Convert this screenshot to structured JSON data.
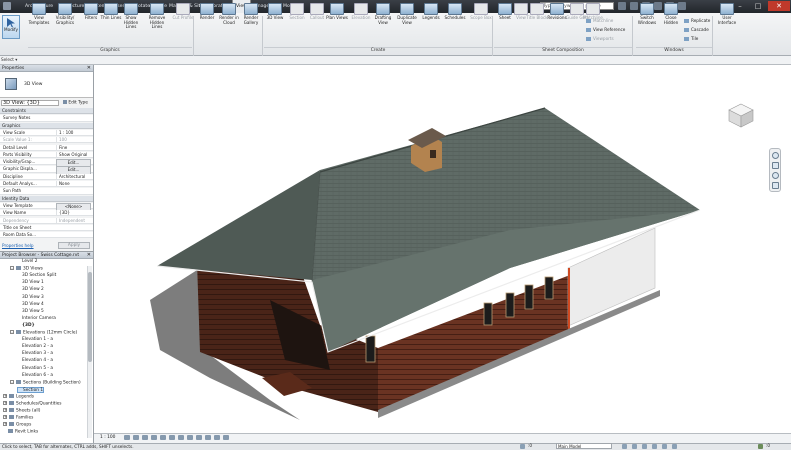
{
  "app": {
    "search_placeholder": "Type a keyword or phrase"
  },
  "tabs": [
    "Architecture",
    "Structure",
    "Systems",
    "Insert",
    "Annotate",
    "Analyze",
    "Massing & Site",
    "Collaborate",
    "View",
    "Manage",
    "Modify"
  ],
  "active_tab_index": 8,
  "ribbon": {
    "modify": "Modify",
    "select": "Select ▾",
    "graphics": {
      "panel_label": "Graphics",
      "buttons": [
        {
          "label": "View Templates",
          "enabled": true
        },
        {
          "label": "Visibility/ Graphics",
          "enabled": true
        },
        {
          "label": "Filters",
          "enabled": true
        },
        {
          "label": "Thin Lines",
          "enabled": true
        },
        {
          "label": "Show Hidden Lines",
          "enabled": true
        },
        {
          "label": "Remove Hidden Lines",
          "enabled": true
        },
        {
          "label": "Cut Profile",
          "enabled": false
        }
      ]
    },
    "presentation": {
      "buttons": [
        {
          "label": "Render",
          "enabled": true
        },
        {
          "label": "Render in Cloud",
          "enabled": true
        },
        {
          "label": "Render Gallery",
          "enabled": true
        }
      ]
    },
    "create": {
      "panel_label": "Create",
      "buttons": [
        {
          "label": "3D View",
          "enabled": true
        },
        {
          "label": "Section",
          "enabled": false
        },
        {
          "label": "Callout",
          "enabled": false
        },
        {
          "label": "Plan Views",
          "enabled": true
        },
        {
          "label": "Elevation",
          "enabled": false
        },
        {
          "label": "Drafting View",
          "enabled": true
        },
        {
          "label": "Duplicate View",
          "enabled": true
        },
        {
          "label": "Legends",
          "enabled": true
        },
        {
          "label": "Schedules",
          "enabled": true
        },
        {
          "label": "Scope Box",
          "enabled": false
        }
      ]
    },
    "sheet_composition": {
      "panel_label": "Sheet Composition",
      "buttons": [
        {
          "label": "Sheet",
          "enabled": true
        },
        {
          "label": "View",
          "enabled": false
        },
        {
          "label": "Title Block",
          "enabled": false
        },
        {
          "label": "Revisions",
          "enabled": true
        },
        {
          "label": "Guide Grid",
          "enabled": false
        },
        {
          "label": "Matchline",
          "enabled": false
        }
      ],
      "small": [
        {
          "label": "Matchline",
          "enabled": false
        },
        {
          "label": "View Reference",
          "enabled": true
        },
        {
          "label": "Viewports",
          "enabled": false
        }
      ]
    },
    "windows": {
      "panel_label": "Windows",
      "buttons": [
        {
          "label": "Switch Windows",
          "enabled": true
        },
        {
          "label": "Close Hidden",
          "enabled": true
        }
      ],
      "small": [
        "Replicate",
        "Cascade",
        "Tile"
      ],
      "ui_button": "User Interface"
    }
  },
  "properties": {
    "title": "Properties",
    "view_type": "3D View",
    "instance_selector": "3D View: {3D}",
    "edit_type": "Edit Type",
    "rows": [
      {
        "kind": "cat",
        "k": "Constraints"
      },
      {
        "kind": "row",
        "k": "Survey Notes",
        "v": ""
      },
      {
        "kind": "cat",
        "k": "Graphics"
      },
      {
        "kind": "row",
        "k": "View Scale",
        "v": "1 : 100"
      },
      {
        "kind": "row",
        "k": "Scale Value  1:",
        "v": "100",
        "dim": true
      },
      {
        "kind": "row",
        "k": "Detail Level",
        "v": "Fine"
      },
      {
        "kind": "row",
        "k": "Parts Visibility",
        "v": "Show Original"
      },
      {
        "kind": "row",
        "k": "Visibility/Grap...",
        "v": "Edit...",
        "btn": true
      },
      {
        "kind": "row",
        "k": "Graphic Displa...",
        "v": "Edit...",
        "btn": true
      },
      {
        "kind": "row",
        "k": "Discipline",
        "v": "Architectural"
      },
      {
        "kind": "row",
        "k": "Default Analys...",
        "v": "None"
      },
      {
        "kind": "row",
        "k": "Sun Path",
        "v": ""
      },
      {
        "kind": "cat",
        "k": "Identity Data"
      },
      {
        "kind": "row",
        "k": "View Template",
        "v": "<None>",
        "btn": true
      },
      {
        "kind": "row",
        "k": "View Name",
        "v": "{3D}"
      },
      {
        "kind": "row",
        "k": "Dependency",
        "v": "Independent",
        "dim": true
      },
      {
        "kind": "row",
        "k": "Title on Sheet",
        "v": ""
      },
      {
        "kind": "row",
        "k": "Room Data So...",
        "v": ""
      }
    ],
    "help_link": "Properties help",
    "apply": "Apply"
  },
  "project_browser": {
    "title": "Project Browser - Swiss Cottage.rvt",
    "items": [
      {
        "depth": 2,
        "label": "Level 2",
        "toggle": ""
      },
      {
        "depth": 1,
        "label": "3D Views",
        "toggle": "-"
      },
      {
        "depth": 2,
        "label": "3D Section Split",
        "toggle": ""
      },
      {
        "depth": 2,
        "label": "3D View 1",
        "toggle": ""
      },
      {
        "depth": 2,
        "label": "3D View 2",
        "toggle": ""
      },
      {
        "depth": 2,
        "label": "3D View 3",
        "toggle": ""
      },
      {
        "depth": 2,
        "label": "3D View 4",
        "toggle": ""
      },
      {
        "depth": 2,
        "label": "3D View 5",
        "toggle": ""
      },
      {
        "depth": 2,
        "label": "Interior Camera",
        "toggle": ""
      },
      {
        "depth": 2,
        "label": "{3D}",
        "toggle": "",
        "bold": true
      },
      {
        "depth": 1,
        "label": "Elevations (12mm Circle)",
        "toggle": "-"
      },
      {
        "depth": 2,
        "label": "Elevation 1 - a",
        "toggle": ""
      },
      {
        "depth": 2,
        "label": "Elevation 2 - a",
        "toggle": ""
      },
      {
        "depth": 2,
        "label": "Elevation 3 - a",
        "toggle": ""
      },
      {
        "depth": 2,
        "label": "Elevation 4 - a",
        "toggle": ""
      },
      {
        "depth": 2,
        "label": "Elevation 5 - a",
        "toggle": ""
      },
      {
        "depth": 2,
        "label": "Elevation 6 - a",
        "toggle": ""
      },
      {
        "depth": 1,
        "label": "Sections (Building Section)",
        "toggle": "-"
      },
      {
        "depth": 2,
        "label": "Section 1",
        "toggle": "",
        "selected": true
      },
      {
        "depth": 0,
        "label": "Legends",
        "toggle": "+"
      },
      {
        "depth": 0,
        "label": "Schedules/Quantities",
        "toggle": "+"
      },
      {
        "depth": 0,
        "label": "Sheets (all)",
        "toggle": "+"
      },
      {
        "depth": 0,
        "label": "Families",
        "toggle": "+"
      },
      {
        "depth": 0,
        "label": "Groups",
        "toggle": "+"
      },
      {
        "depth": 0,
        "label": "Revit Links",
        "toggle": ""
      }
    ]
  },
  "view_control": {
    "scale": "1 : 100"
  },
  "status": {
    "text": "Click to select, TAB for alternates, CTRL adds, SHIFT unselects.",
    "model": "Main Model",
    "zero": ":0"
  },
  "colors": {
    "roof": "#5f6b66",
    "wood": "#5a2d1e",
    "siding": "#ebebeb",
    "ribbon_accent": "#2f63a0"
  }
}
